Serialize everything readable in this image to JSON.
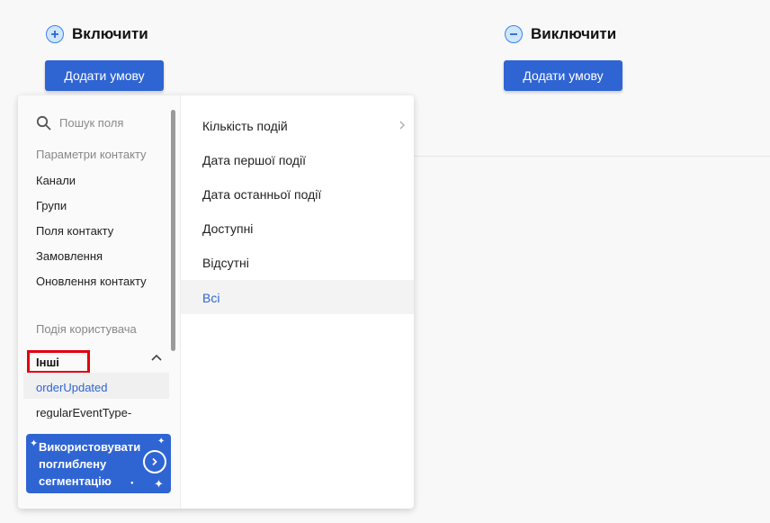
{
  "include": {
    "title": "Включити",
    "add_button": "Додати умову"
  },
  "exclude": {
    "title": "Виключити",
    "add_button": "Додати умову"
  },
  "field_picker": {
    "search_placeholder": "Пошук поля",
    "categories": {
      "contact_params": {
        "label": "Параметри контакту",
        "items": [
          "Канали",
          "Групи",
          "Поля контакту",
          "Замовлення",
          "Оновлення контакту"
        ]
      },
      "user_events": {
        "label": "Подія користувача"
      }
    },
    "others_group": {
      "label": "Інші",
      "items": [
        "orderUpdated",
        "regularEventType-"
      ]
    },
    "promo": {
      "text": "Використовувати поглиблену сегментацію"
    },
    "event_options": [
      "Кількість подій",
      "Дата першої події",
      "Дата останньої події",
      "Доступні",
      "Відсутні",
      "Всі"
    ],
    "selected_option": "Всі"
  },
  "colors": {
    "accent": "#2f64d3",
    "highlight": "#e3000f"
  }
}
